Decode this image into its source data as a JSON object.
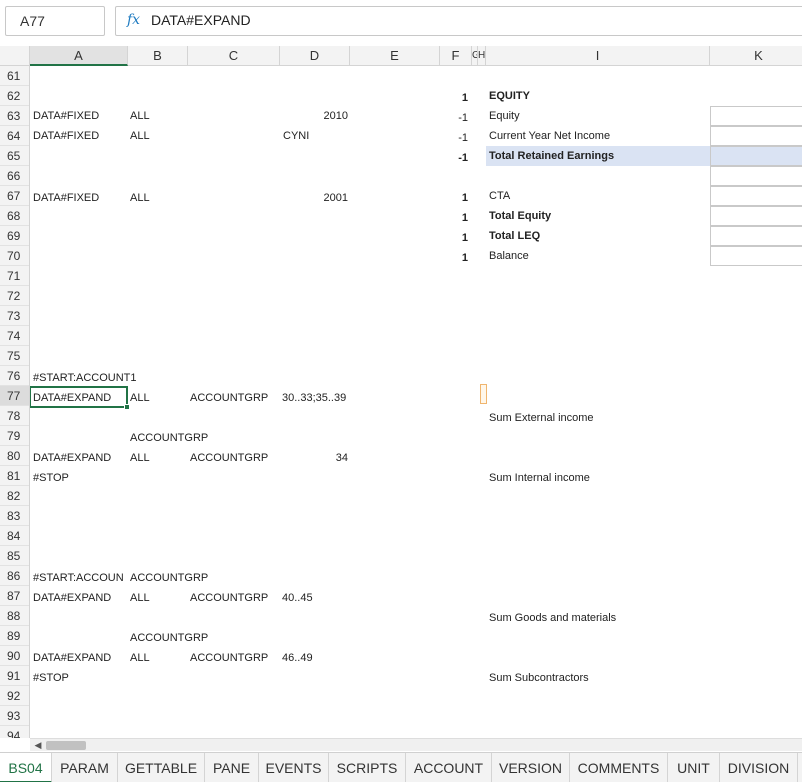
{
  "formula_bar": {
    "name_box": "A77",
    "fx_icon": "fx-icon",
    "formula": "DATA#EXPAND"
  },
  "columns": [
    "A",
    "B",
    "C",
    "D",
    "E",
    "F",
    "G",
    "H",
    "I",
    "K"
  ],
  "rows": [
    "61",
    "62",
    "63",
    "64",
    "65",
    "66",
    "67",
    "68",
    "69",
    "70",
    "71",
    "72",
    "73",
    "74",
    "75",
    "76",
    "77",
    "78",
    "79",
    "80",
    "81",
    "82",
    "83",
    "84",
    "85",
    "86",
    "87",
    "88",
    "89",
    "90",
    "91",
    "92",
    "93",
    "94"
  ],
  "selected_row": "77",
  "cells": {
    "r62": {
      "e": "1",
      "i": "EQUITY"
    },
    "r63": {
      "a": "DATA#FIXED",
      "b": "ALL",
      "d": "2010",
      "e": "-1",
      "i": "Equity"
    },
    "r64": {
      "a": "DATA#FIXED",
      "b": "ALL",
      "d": "CYNI",
      "e": "-1",
      "i": "Current Year Net Income"
    },
    "r65": {
      "e": "-1",
      "i": "Total Retained Earnings"
    },
    "r67": {
      "a": "DATA#FIXED",
      "b": "ALL",
      "d": "2001",
      "e": "1",
      "i": "CTA"
    },
    "r68": {
      "e": "1",
      "i": "Total Equity"
    },
    "r69": {
      "e": "1",
      "i": "Total LEQ"
    },
    "r70": {
      "e": "1",
      "i": "Balance"
    },
    "r76": {
      "a": "#START:ACCOUNT1"
    },
    "r77": {
      "a": "DATA#EXPAND",
      "b": "ALL",
      "c": "ACCOUNTGRP",
      "d": "30..33;35..39"
    },
    "r78": {
      "i": "Sum External income"
    },
    "r79": {
      "b": "ACCOUNTGRP"
    },
    "r80": {
      "a": "DATA#EXPAND",
      "b": "ALL",
      "c": "ACCOUNTGRP",
      "d": "34"
    },
    "r81": {
      "a": "#STOP",
      "i": "Sum Internal income"
    },
    "r86": {
      "a": "#START:ACCOUN",
      "b": "ACCOUNTGRP"
    },
    "r87": {
      "a": "DATA#EXPAND",
      "b": "ALL",
      "c": "ACCOUNTGRP",
      "d": "40..45"
    },
    "r88": {
      "i": "Sum Goods and materials"
    },
    "r89": {
      "b": "ACCOUNTGRP"
    },
    "r90": {
      "a": "DATA#EXPAND",
      "b": "ALL",
      "c": "ACCOUNTGRP",
      "d": "46..49"
    },
    "r91": {
      "a": "#STOP",
      "i": "Sum Subcontractors"
    }
  },
  "scrollbar": {
    "left_arrow": "◀"
  },
  "tabs": [
    "BS04",
    "PARAM",
    "GETTABLE",
    "PANE",
    "EVENTS",
    "SCRIPTS",
    "ACCOUNT",
    "VERSION",
    "COMMENTS",
    "UNIT",
    "DIVISION"
  ],
  "active_tab": "BS04",
  "colors": {
    "accent": "#217346",
    "highlight": "#dae3f3",
    "fx": "#1f7bc1"
  }
}
